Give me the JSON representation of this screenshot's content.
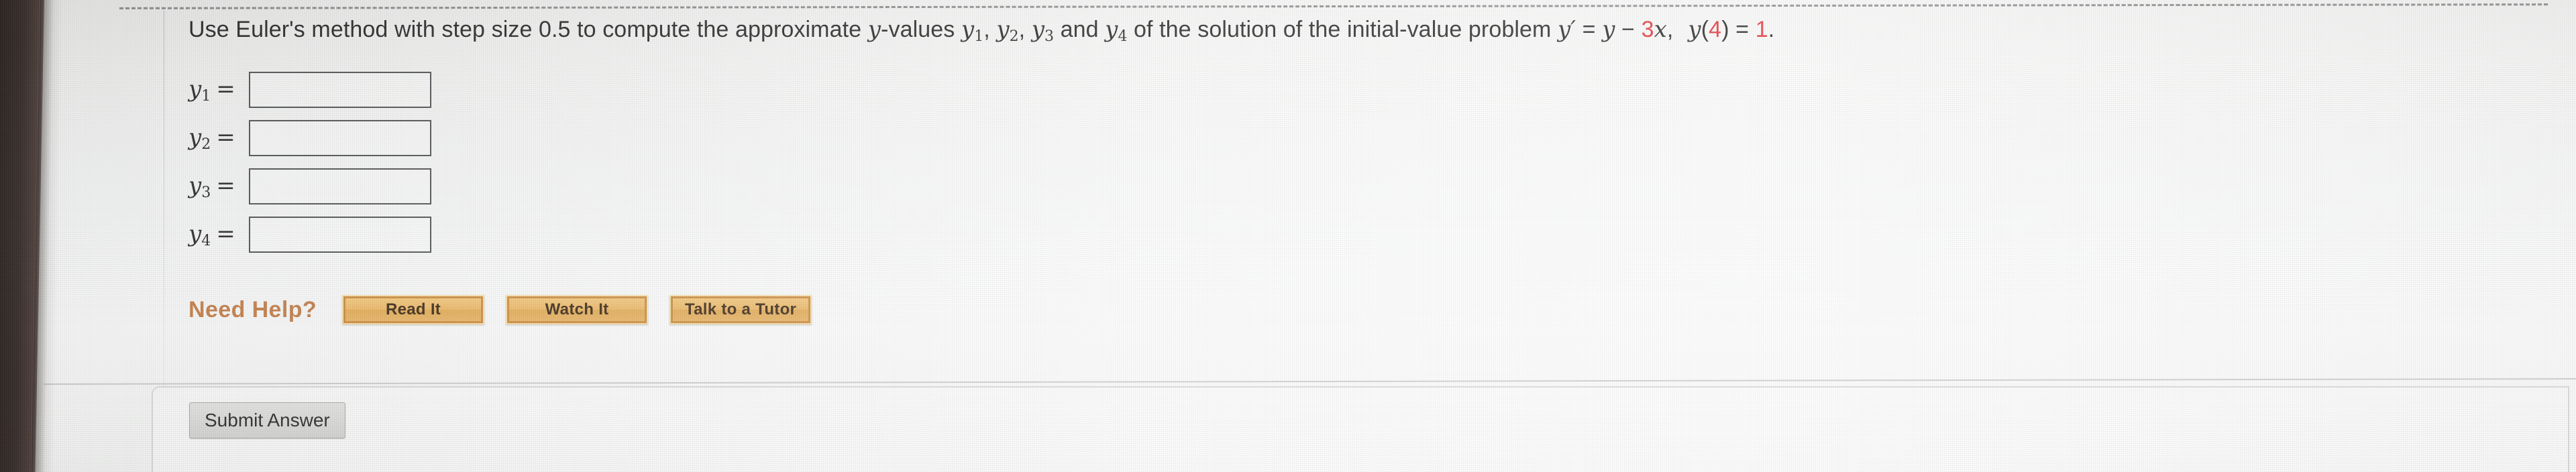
{
  "question": {
    "lead": "Use Euler's method with step size 0.5 to compute the approximate ",
    "y_values_phrase": "-values ",
    "var_y": "y",
    "y1": "y",
    "y1sub": "1",
    "y2": "y",
    "y2sub": "2",
    "y3": "y",
    "y3sub": "3",
    "y4": "y",
    "y4sub": "4",
    "sep1": ", ",
    "sep2": ", ",
    "and": " and ",
    "tail": " of the solution of the initial-value problem ",
    "eq_yprime": "y′",
    "eq_equals": " = ",
    "eq_y": "y",
    "eq_minus": " − ",
    "eq_three": "3",
    "eq_x": "x",
    "eq_comma": ",",
    "ivp_y": "y",
    "ivp_open": "(",
    "ivp_four": "4",
    "ivp_close": ")",
    "ivp_equals": " = ",
    "ivp_one": "1",
    "ivp_period": ".",
    "accent_red": "#e0383e"
  },
  "answers": [
    {
      "label": "y",
      "sub": "1",
      "equals": "=",
      "value": "",
      "placeholder": ""
    },
    {
      "label": "y",
      "sub": "2",
      "equals": "=",
      "value": "",
      "placeholder": ""
    },
    {
      "label": "y",
      "sub": "3",
      "equals": "=",
      "value": "",
      "placeholder": ""
    },
    {
      "label": "y",
      "sub": "4",
      "equals": "=",
      "value": "",
      "placeholder": ""
    }
  ],
  "need_help": {
    "label": "Need Help?",
    "label_color": "#c07d4a",
    "buttons": [
      {
        "label": "Read It"
      },
      {
        "label": "Watch It"
      },
      {
        "label": "Talk to a Tutor"
      }
    ]
  },
  "footer": {
    "submit_label": "Submit Answer"
  }
}
